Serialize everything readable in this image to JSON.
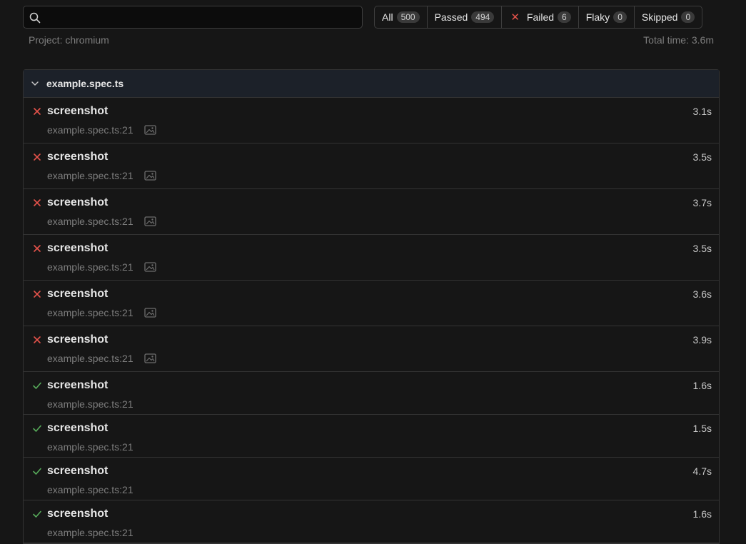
{
  "search": {
    "value": "",
    "placeholder": ""
  },
  "filters": [
    {
      "label": "All",
      "count": "500"
    },
    {
      "label": "Passed",
      "count": "494"
    },
    {
      "label": "Failed",
      "count": "6"
    },
    {
      "label": "Flaky",
      "count": "0"
    },
    {
      "label": "Skipped",
      "count": "0"
    }
  ],
  "project": "Project: chromium",
  "total_time": "Total time: 3.6m",
  "suite": {
    "name": "example.spec.ts",
    "tests": [
      {
        "status": "failed",
        "title": "screenshot",
        "location": "example.spec.ts:21",
        "duration": "3.1s",
        "has_image": true
      },
      {
        "status": "failed",
        "title": "screenshot",
        "location": "example.spec.ts:21",
        "duration": "3.5s",
        "has_image": true
      },
      {
        "status": "failed",
        "title": "screenshot",
        "location": "example.spec.ts:21",
        "duration": "3.7s",
        "has_image": true
      },
      {
        "status": "failed",
        "title": "screenshot",
        "location": "example.spec.ts:21",
        "duration": "3.5s",
        "has_image": true
      },
      {
        "status": "failed",
        "title": "screenshot",
        "location": "example.spec.ts:21",
        "duration": "3.6s",
        "has_image": true
      },
      {
        "status": "failed",
        "title": "screenshot",
        "location": "example.spec.ts:21",
        "duration": "3.9s",
        "has_image": true
      },
      {
        "status": "passed",
        "title": "screenshot",
        "location": "example.spec.ts:21",
        "duration": "1.6s",
        "has_image": false
      },
      {
        "status": "passed",
        "title": "screenshot",
        "location": "example.spec.ts:21",
        "duration": "1.5s",
        "has_image": false
      },
      {
        "status": "passed",
        "title": "screenshot",
        "location": "example.spec.ts:21",
        "duration": "4.7s",
        "has_image": false
      },
      {
        "status": "passed",
        "title": "screenshot",
        "location": "example.spec.ts:21",
        "duration": "1.6s",
        "has_image": false
      }
    ]
  },
  "colors": {
    "failed": "#e5534b",
    "passed": "#57ab5a",
    "background": "#161616",
    "header": "#1c2129"
  },
  "icons": {
    "search": "search-icon",
    "failed": "x-icon",
    "passed": "check-icon",
    "image": "image-icon",
    "chevron": "chevron-down-icon"
  }
}
